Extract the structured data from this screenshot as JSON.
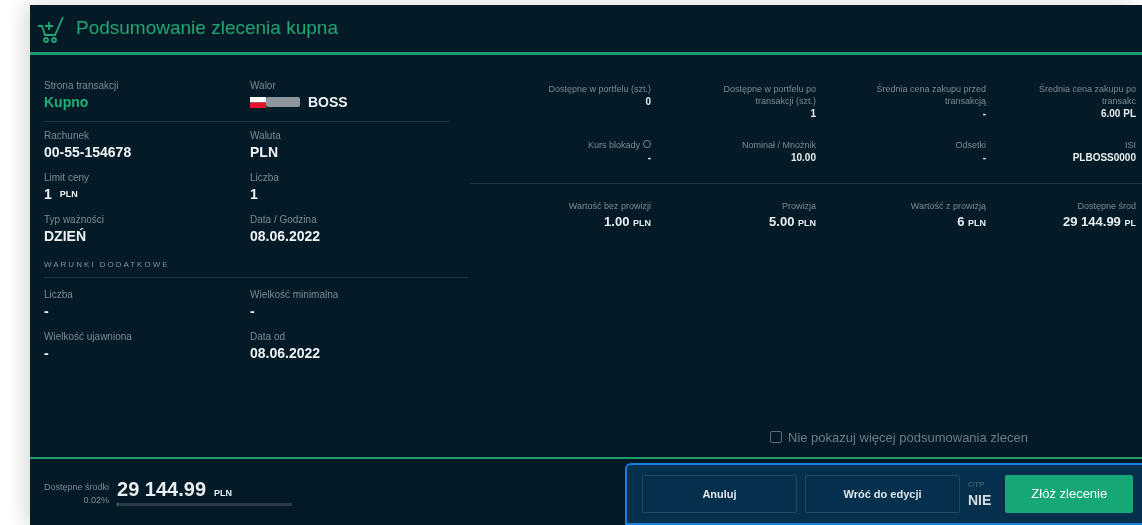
{
  "header": {
    "title": "Podsumowanie zlecenia kupna"
  },
  "fields": [
    {
      "label": "Strona transakcji",
      "value": "Kupno",
      "kind": "side"
    },
    {
      "label": "Walor",
      "value": "BOSS",
      "kind": "instrument"
    },
    {
      "label": "Rachunek",
      "value": "00-55-154678",
      "kind": "plain"
    },
    {
      "label": "Waluta",
      "value": "PLN",
      "kind": "plain"
    },
    {
      "label": "Limit ceny",
      "value": "1",
      "unit": "PLN",
      "kind": "plain"
    },
    {
      "label": "Liczba",
      "value": "1",
      "kind": "plain"
    },
    {
      "label": "Typ ważności",
      "value": "DZIEŃ",
      "kind": "plain"
    },
    {
      "label": "Data / Godzina",
      "value": "08.06.2022",
      "kind": "plain"
    }
  ],
  "extra_section": {
    "title": "WARUNKI DODATKOWE",
    "fields": [
      {
        "label": "Liczba",
        "value": "-"
      },
      {
        "label": "Wielkość minimalna",
        "value": "-"
      },
      {
        "label": "Wielkość ujawniona",
        "value": "-"
      },
      {
        "label": "Data od",
        "value": "08.06.2022"
      }
    ]
  },
  "metric_rows": [
    [
      {
        "label": "Dostępne w portfelu (szt.)",
        "value": "0"
      },
      {
        "label": "Dostępne w portfelu po transakcji (szt.)",
        "value": "1"
      },
      {
        "label": "Średnia cena zakupu przed transakcją",
        "value": "-"
      },
      {
        "label": "Średnia cena zakupu po transakc",
        "value": "6.00 PL"
      }
    ],
    [
      {
        "label": "Kurs blokady",
        "info": true,
        "value": "-"
      },
      {
        "label": "Nominał / Mnożnik",
        "value": "10.00"
      },
      {
        "label": "Odsetki",
        "value": "-"
      },
      {
        "label": "ISI",
        "value": "PLBOSS0000"
      }
    ],
    [
      {
        "label": "Wartość bez prowizji",
        "value": "1.00",
        "unit": "PLN"
      },
      {
        "label": "Prowizja",
        "value": "5.00",
        "unit": "PLN"
      },
      {
        "label": "Wartość z prowizją",
        "value": "6",
        "unit": "PLN"
      },
      {
        "label": "Dostępne środ",
        "value": "29 144.99",
        "unit": "PL"
      }
    ]
  ],
  "dont_show": {
    "label": "Nie pokazuj więcej podsumowania zlecen",
    "checked": false
  },
  "funds": {
    "label": "Dostępne środki",
    "value": "29 144.99",
    "unit": "PLN",
    "percent": "0.02%",
    "level": 0.0002
  },
  "buttons": [
    {
      "label": "Anuluj",
      "kind": "outline"
    },
    {
      "label": "Wróć do edycji",
      "kind": "outline"
    }
  ],
  "otp": {
    "label": "OTP",
    "value": "NIE"
  },
  "submit": {
    "label": "Złóż zlecenie"
  }
}
